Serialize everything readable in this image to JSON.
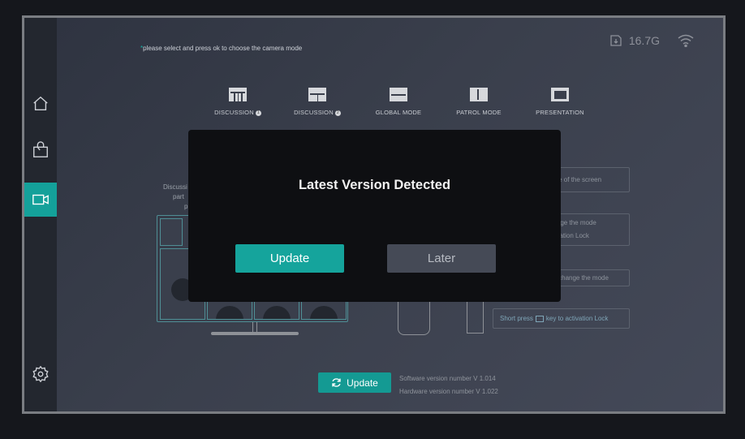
{
  "hint": {
    "star": "*",
    "text": "please select and press ok to choose the camera mode"
  },
  "status": {
    "storage": "16.7G",
    "storage_icon": "sd-card-icon",
    "wifi_icon": "wifi-icon"
  },
  "sidebar": {
    "items": [
      {
        "icon": "home-icon"
      },
      {
        "icon": "bag-icon"
      },
      {
        "icon": "video-camera-icon",
        "active": true
      },
      {
        "icon": "gear-icon"
      }
    ]
  },
  "modes": [
    {
      "label": "DISCUSSION",
      "badge": "1",
      "icon": "grid-four-icon"
    },
    {
      "label": "DISCUSSION",
      "badge": "2",
      "icon": "grid-split-icon"
    },
    {
      "label": "GLOBAL MODE",
      "icon": "horizontal-split-icon"
    },
    {
      "label": "PATROL MODE",
      "icon": "vertical-split-icon"
    },
    {
      "label": "PRESENTATION",
      "icon": "screen-icon"
    }
  ],
  "background": {
    "left_text": [
      "Discussi",
      "part",
      "p"
    ],
    "right_boxes": [
      "angle of the screen",
      "change the mode",
      "activation Lock",
      "y to change the mode"
    ],
    "shortpress": {
      "prefix": "Short press",
      "suffix": "key to activation Lock"
    }
  },
  "update": {
    "label": "Update"
  },
  "versions": {
    "software": "Software version number  V 1.014",
    "hardware": "Hardware version number  V 1.022"
  },
  "modal": {
    "title": "Latest Version Detected",
    "update_label": "Update",
    "later_label": "Later"
  },
  "colors": {
    "accent": "#15a49c",
    "modal_bg": "#0e0f12",
    "secondary_btn": "#454a56"
  }
}
